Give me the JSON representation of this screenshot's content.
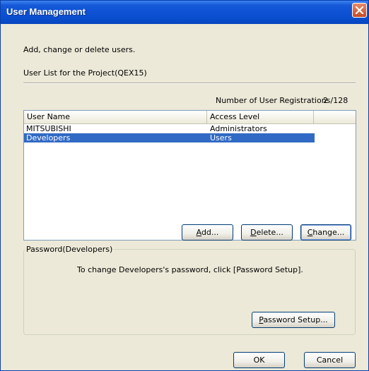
{
  "window": {
    "title": "User Management"
  },
  "intro_text": "Add, change or delete users.",
  "list_caption": "User List for the Project(QEX15)",
  "registrations": {
    "label": "Number of User Registrations",
    "value": "2 /128"
  },
  "table": {
    "columns": [
      "User Name",
      "Access Level"
    ],
    "rows": [
      {
        "name": "MITSUBISHI",
        "level": "Administrators",
        "selected": false
      },
      {
        "name": "Developers",
        "level": "Users",
        "selected": true
      }
    ]
  },
  "buttons": {
    "add": {
      "accel": "A",
      "rest": "dd..."
    },
    "delete": {
      "accel": "D",
      "rest": "elete..."
    },
    "change": {
      "accel": "C",
      "rest": "hange..."
    },
    "password_setup": {
      "accel": "P",
      "rest": "assword Setup..."
    },
    "ok": "OK",
    "cancel": "Cancel"
  },
  "password_group": {
    "title": "Password(Developers)",
    "message": "To change Developers's password, click [Password Setup]."
  },
  "colors": {
    "titlebar": "#0a4fd0",
    "selection": "#316ac5",
    "dialog_bg": "#ece9d8"
  },
  "icons": {
    "close": "close-icon"
  }
}
